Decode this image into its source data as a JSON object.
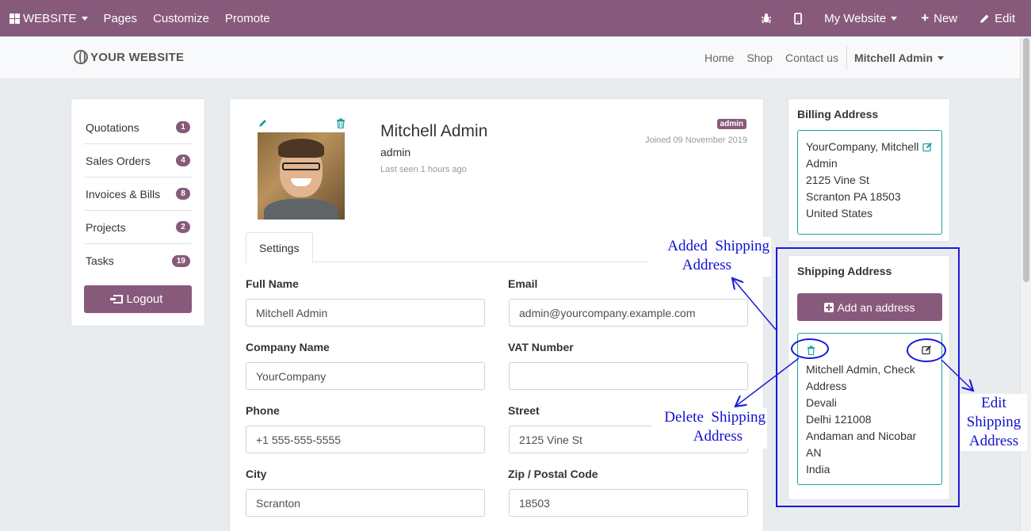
{
  "topbar": {
    "website": "WEBSITE",
    "pages": "Pages",
    "customize": "Customize",
    "promote": "Promote",
    "my_website": "My Website",
    "new": "New",
    "edit": "Edit"
  },
  "site": {
    "logo": "YOUR WEBSITE",
    "nav": [
      "Home",
      "Shop",
      "Contact us"
    ],
    "user": "Mitchell Admin"
  },
  "menu": {
    "items": [
      {
        "label": "Quotations",
        "count": "1"
      },
      {
        "label": "Sales Orders",
        "count": "4"
      },
      {
        "label": "Invoices & Bills",
        "count": "8"
      },
      {
        "label": "Projects",
        "count": "2"
      },
      {
        "label": "Tasks",
        "count": "19"
      }
    ],
    "logout": "Logout"
  },
  "profile": {
    "name": "Mitchell Admin",
    "login": "admin",
    "last_seen": "Last seen 1 hours ago",
    "badge": "admin",
    "joined": "Joined 09 November 2019"
  },
  "tabs": {
    "settings": "Settings"
  },
  "form": {
    "full_name_label": "Full Name",
    "full_name": "Mitchell Admin",
    "email_label": "Email",
    "email": "admin@yourcompany.example.com",
    "company_label": "Company Name",
    "company": "YourCompany",
    "vat_label": "VAT Number",
    "vat": "",
    "phone_label": "Phone",
    "phone": "+1 555-555-5555",
    "street_label": "Street",
    "street": "2125 Vine St",
    "city_label": "City",
    "city": "Scranton",
    "zip_label": "Zip / Postal Code",
    "zip": "18503"
  },
  "billing": {
    "title": "Billing Address",
    "lines": [
      "YourCompany, Mitchell",
      "Admin",
      "2125 Vine St",
      "Scranton PA 18503",
      "United States"
    ]
  },
  "shipping": {
    "title": "Shipping Address",
    "add": "Add an address",
    "lines": [
      "Mitchell Admin, Check",
      "Address",
      "Devali",
      "Delhi 121008",
      "Andaman and Nicobar",
      "AN",
      "India"
    ]
  },
  "annotations": {
    "added_1": "Added  Shipping",
    "added_2": "Address",
    "delete_1": "Delete  Shipping",
    "delete_2": "Address",
    "edit_1": "Edit",
    "edit_2": "Shipping",
    "edit_3": "Address"
  },
  "colors": {
    "brand": "#875a7b",
    "teal": "#1fa09b",
    "annotation": "#1a1adb"
  }
}
